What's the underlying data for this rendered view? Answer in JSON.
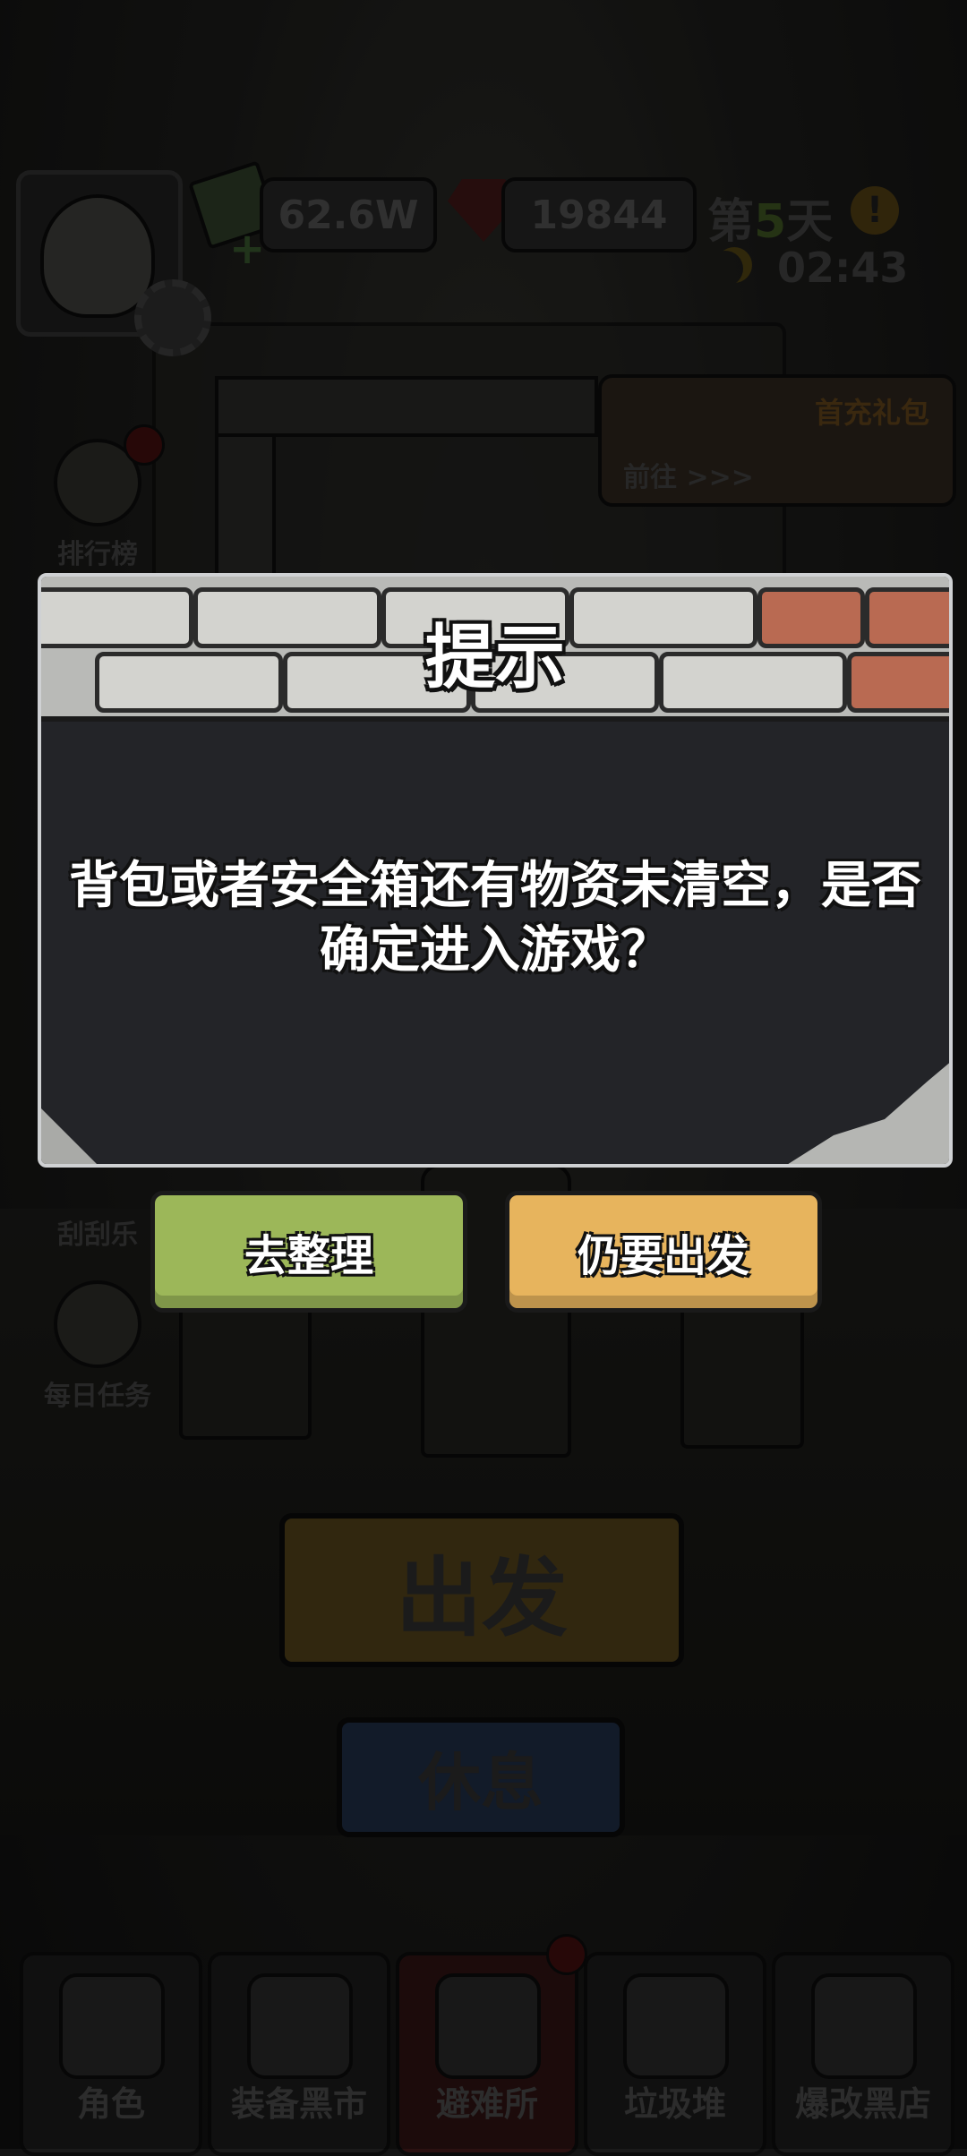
{
  "hud": {
    "cash": "62.6W",
    "gems": "19844",
    "day_prefix": "第",
    "day_number": "5",
    "day_suffix": "天",
    "time": "02:43"
  },
  "side_menu": [
    {
      "label": "排行榜"
    },
    {
      "label": "刮刮乐"
    },
    {
      "label": "每日任务"
    }
  ],
  "gift_banner": {
    "title": "首充礼包",
    "go_label": "前往 >>>"
  },
  "background_buttons": {
    "depart": "出发",
    "rest": "休息"
  },
  "bottom_nav": [
    {
      "label": "角色"
    },
    {
      "label": "装备黑市"
    },
    {
      "label": "避难所"
    },
    {
      "label": "垃圾堆"
    },
    {
      "label": "爆改黑店"
    }
  ],
  "dialog": {
    "title": "提示",
    "message": "背包或者安全箱还有物资未清空，是否确定进入游戏？",
    "buttons": {
      "organize": "去整理",
      "depart_anyway": "仍要出发"
    }
  },
  "colors": {
    "organize_button": "#9cb759",
    "depart_button": "#e7b45d",
    "dialog_body": "#232428"
  }
}
